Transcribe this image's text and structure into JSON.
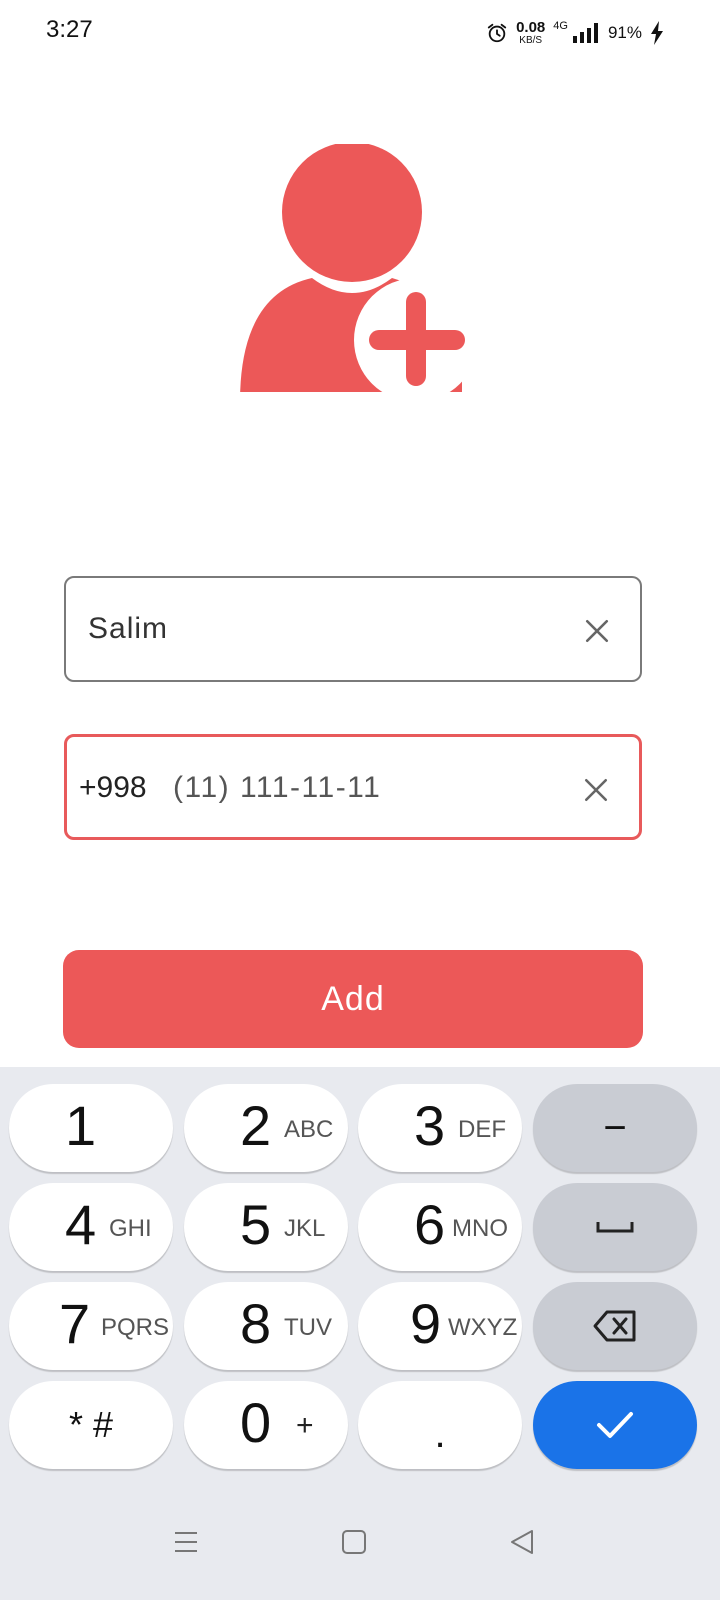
{
  "status_bar": {
    "time": "3:27",
    "alarm_icon": "alarm-clock-icon",
    "net_speed_value": "0.08",
    "net_speed_unit": "KB/S",
    "network_type": "4G",
    "signal_icon": "signal-bars-icon",
    "battery_percent": "91%",
    "charging_icon": "lightning-bolt-icon"
  },
  "avatar": {
    "icon": "add-user-icon",
    "color": "#ec5858"
  },
  "form": {
    "name_value": "Salim",
    "phone_prefix": "+998",
    "phone_mask": "(11) 111-11-11",
    "clear_icon": "close-icon"
  },
  "add_button": {
    "label": "Add",
    "color": "#ec5858"
  },
  "keyboard": {
    "keys": [
      {
        "digit": "1",
        "letters": ""
      },
      {
        "digit": "2",
        "letters": "ABC"
      },
      {
        "digit": "3",
        "letters": "DEF"
      },
      {
        "digit": "4",
        "letters": "GHI"
      },
      {
        "digit": "5",
        "letters": "JKL"
      },
      {
        "digit": "6",
        "letters": "MNO"
      },
      {
        "digit": "7",
        "letters": "PQRS"
      },
      {
        "digit": "8",
        "letters": "TUV"
      },
      {
        "digit": "9",
        "letters": "WXYZ"
      },
      {
        "digit": "0",
        "letters": "+"
      }
    ],
    "star_hash": "* #",
    "dot": ".",
    "minus": "−",
    "space_icon": "space-bar-icon",
    "backspace_icon": "backspace-icon",
    "done_icon": "checkmark-icon",
    "done_color": "#1a73e8"
  },
  "nav_bar": {
    "menu_icon": "menu-lines-icon",
    "home_icon": "square-home-icon",
    "back_icon": "triangle-back-icon"
  }
}
